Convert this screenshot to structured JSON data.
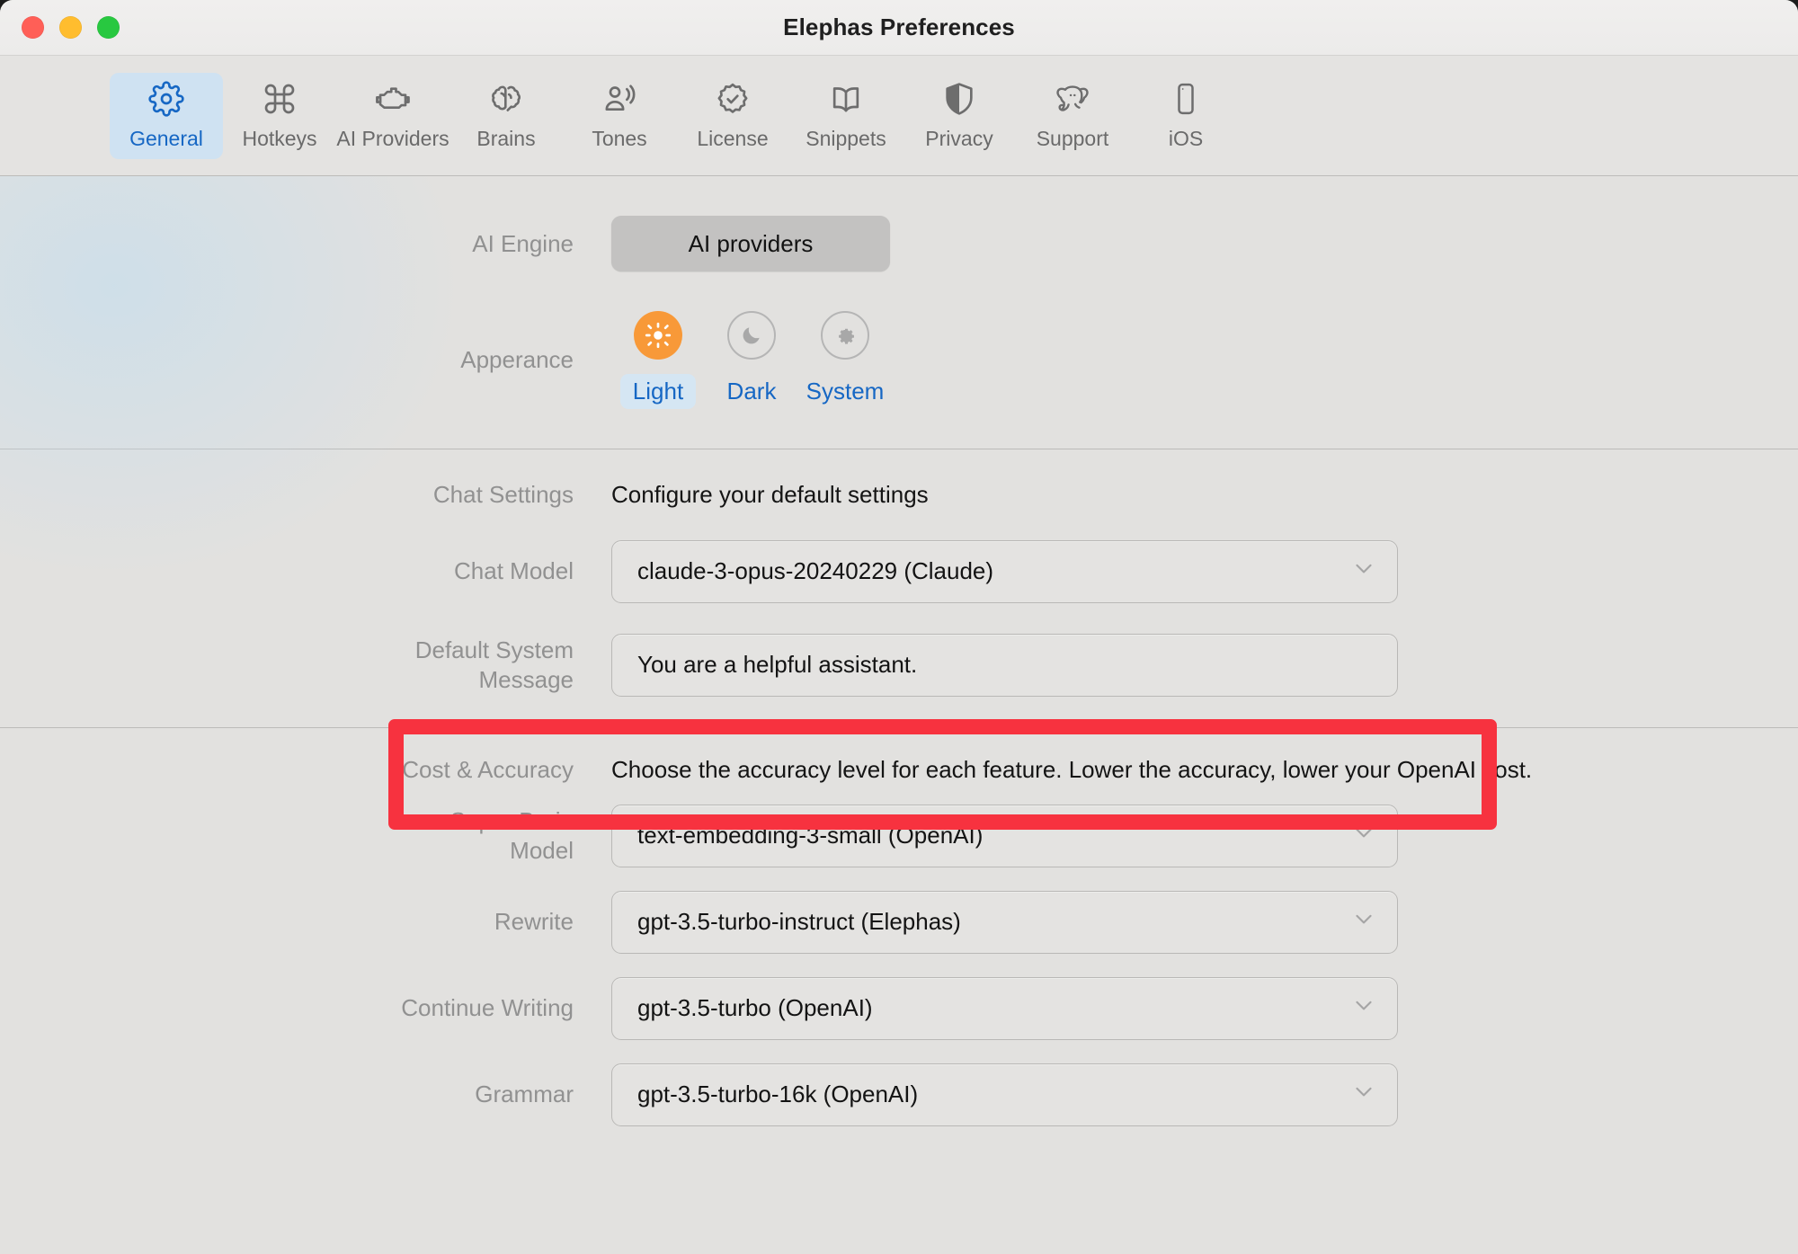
{
  "window": {
    "title": "Elephas Preferences",
    "traffic_lights": [
      {
        "name": "close",
        "color": "#ff5f57"
      },
      {
        "name": "minimize",
        "color": "#ffbd2e"
      },
      {
        "name": "zoom",
        "color": "#28c840"
      }
    ]
  },
  "toolbar": {
    "active_tab": "General",
    "tabs": [
      {
        "label": "General",
        "icon": "gear-icon"
      },
      {
        "label": "Hotkeys",
        "icon": "command-key-icon"
      },
      {
        "label": "AI Providers",
        "icon": "engine-icon"
      },
      {
        "label": "Brains",
        "icon": "brain-icon"
      },
      {
        "label": "Tones",
        "icon": "person-speaking-icon"
      },
      {
        "label": "License",
        "icon": "seal-checkmark-icon"
      },
      {
        "label": "Snippets",
        "icon": "open-book-icon"
      },
      {
        "label": "Privacy",
        "icon": "shield-icon"
      },
      {
        "label": "Support",
        "icon": "elephant-icon"
      },
      {
        "label": "iOS",
        "icon": "iphone-icon"
      }
    ]
  },
  "general": {
    "ai_engine": {
      "label": "AI Engine",
      "button_label": "AI providers"
    },
    "appearance": {
      "label": "Apperance",
      "selected": "Light",
      "options": [
        {
          "label": "Light",
          "icon": "sun-icon"
        },
        {
          "label": "Dark",
          "icon": "moon-icon"
        },
        {
          "label": "System",
          "icon": "gear-icon"
        }
      ]
    },
    "chat_settings": {
      "label": "Chat Settings",
      "description": "Configure your default settings",
      "chat_model": {
        "label": "Chat Model",
        "value": "claude-3-opus-20240229 (Claude)"
      },
      "default_system_message": {
        "label": "Default System Message",
        "label_line1": "Default System",
        "label_line2": "Message",
        "value": "You are a helpful assistant."
      }
    },
    "cost_accuracy": {
      "label": "Cost & Accuracy",
      "description": "Choose the accuracy level for each feature. Lower the accuracy, lower your OpenAI cost.",
      "rows": [
        {
          "label_line1": "Super Brain",
          "label_line2": "Model",
          "value": "text-embedding-3-small (OpenAI)"
        },
        {
          "label_line1": "Rewrite",
          "label_line2": "",
          "value": "gpt-3.5-turbo-instruct (Elephas)"
        },
        {
          "label_line1": "Continue Writing",
          "label_line2": "",
          "value": "gpt-3.5-turbo (OpenAI)"
        },
        {
          "label_line1": "Grammar",
          "label_line2": "",
          "value": "gpt-3.5-turbo-16k (OpenAI)"
        }
      ]
    }
  },
  "annotation": {
    "highlight_color": "#f7323f",
    "target": "Chat Model"
  }
}
